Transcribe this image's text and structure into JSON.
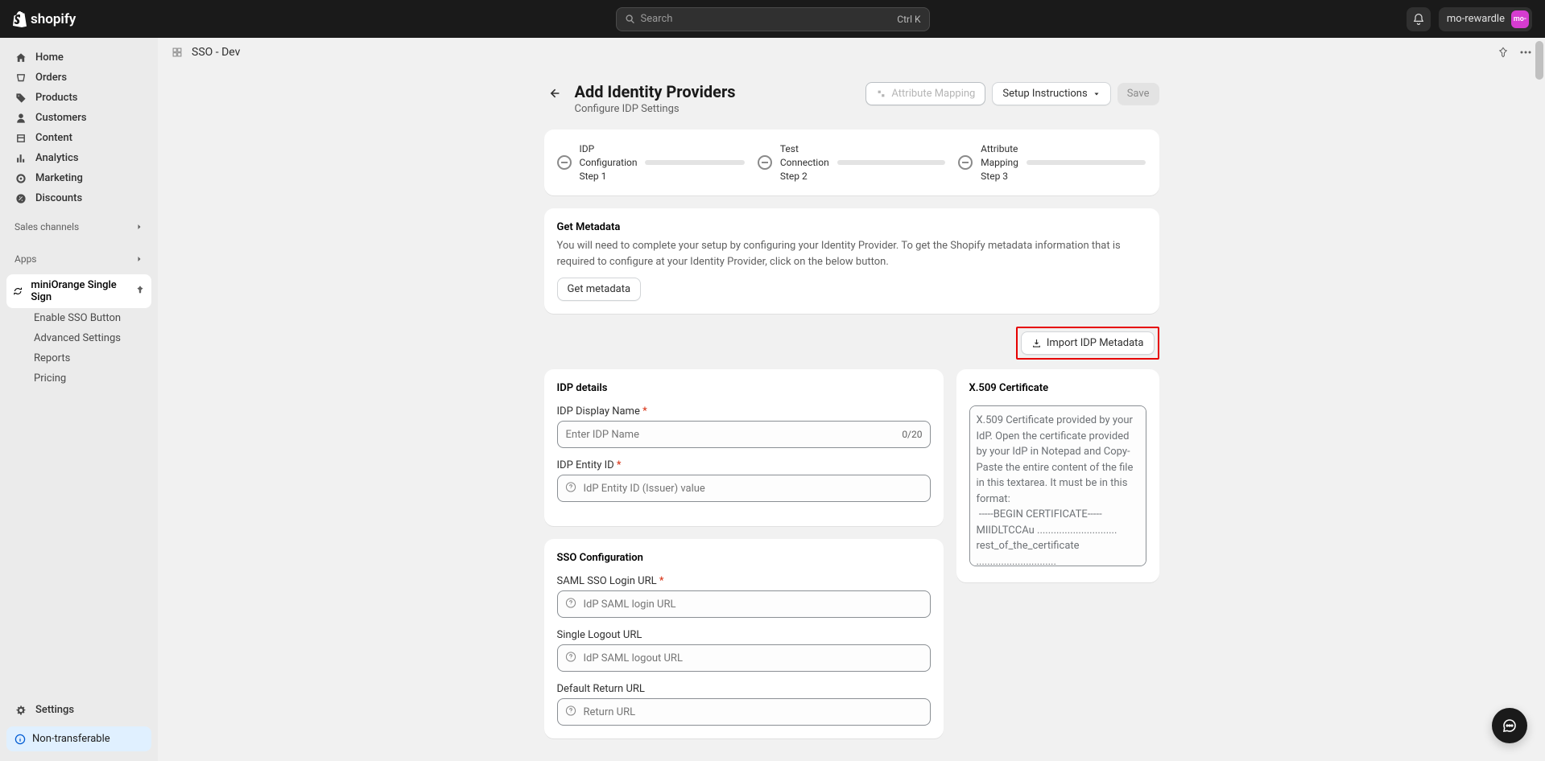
{
  "brand": "shopify",
  "search": {
    "placeholder": "Search",
    "shortcut": "Ctrl K"
  },
  "user": {
    "name": "mo-rewardle",
    "initials": "mo-"
  },
  "nav": {
    "home": "Home",
    "orders": "Orders",
    "products": "Products",
    "customers": "Customers",
    "content": "Content",
    "analytics": "Analytics",
    "marketing": "Marketing",
    "discounts": "Discounts",
    "salesChannels": "Sales channels",
    "apps": "Apps",
    "app": "miniOrange Single Sign",
    "sub": {
      "enable": "Enable SSO Button",
      "advanced": "Advanced Settings",
      "reports": "Reports",
      "pricing": "Pricing"
    },
    "settings": "Settings",
    "nontransferable": "Non-transferable"
  },
  "breadcrumb": "SSO - Dev",
  "header": {
    "title": "Add Identity Providers",
    "subtitle": "Configure IDP Settings",
    "attrMapping": "Attribute Mapping",
    "setupInstructions": "Setup Instructions",
    "save": "Save"
  },
  "steps": {
    "s1a": "IDP",
    "s1b": "Configuration",
    "s1c": "Step 1",
    "s2a": "Test",
    "s2b": "Connection",
    "s2c": "Step 2",
    "s3a": "Attribute",
    "s3b": "Mapping",
    "s3c": "Step 3"
  },
  "metadata": {
    "title": "Get Metadata",
    "desc": "You will need to complete your setup by configuring your Identity Provider. To get the Shopify metadata information that is required to configure at your Identity Provider, click on the below button.",
    "button": "Get metadata"
  },
  "import": "Import IDP Metadata",
  "idpDetails": {
    "title": "IDP details",
    "displayName": "IDP Display Name",
    "displayPlaceholder": "Enter IDP Name",
    "charCount": "0/20",
    "entityId": "IDP Entity ID",
    "entityPlaceholder": "IdP Entity ID (Issuer) value"
  },
  "ssoConfig": {
    "title": "SSO Configuration",
    "loginUrl": "SAML SSO Login URL",
    "loginPlaceholder": "IdP SAML login URL",
    "logoutUrl": "Single Logout URL",
    "logoutPlaceholder": "IdP SAML logout URL",
    "returnUrl": "Default Return URL",
    "returnPlaceholder": "Return URL"
  },
  "cert": {
    "title": "X.509 Certificate",
    "placeholder": "X.509 Certificate provided by your IdP. Open the certificate provided by your IdP in Notepad and Copy-Paste the entire content of the file in this textarea. It must be in this format:\n -----BEGIN CERTIFICATE-----\nMIIDLTCCAu .............................\nrest_of_the_certificate .............................\n-----END CERTIFICATE-----"
  }
}
